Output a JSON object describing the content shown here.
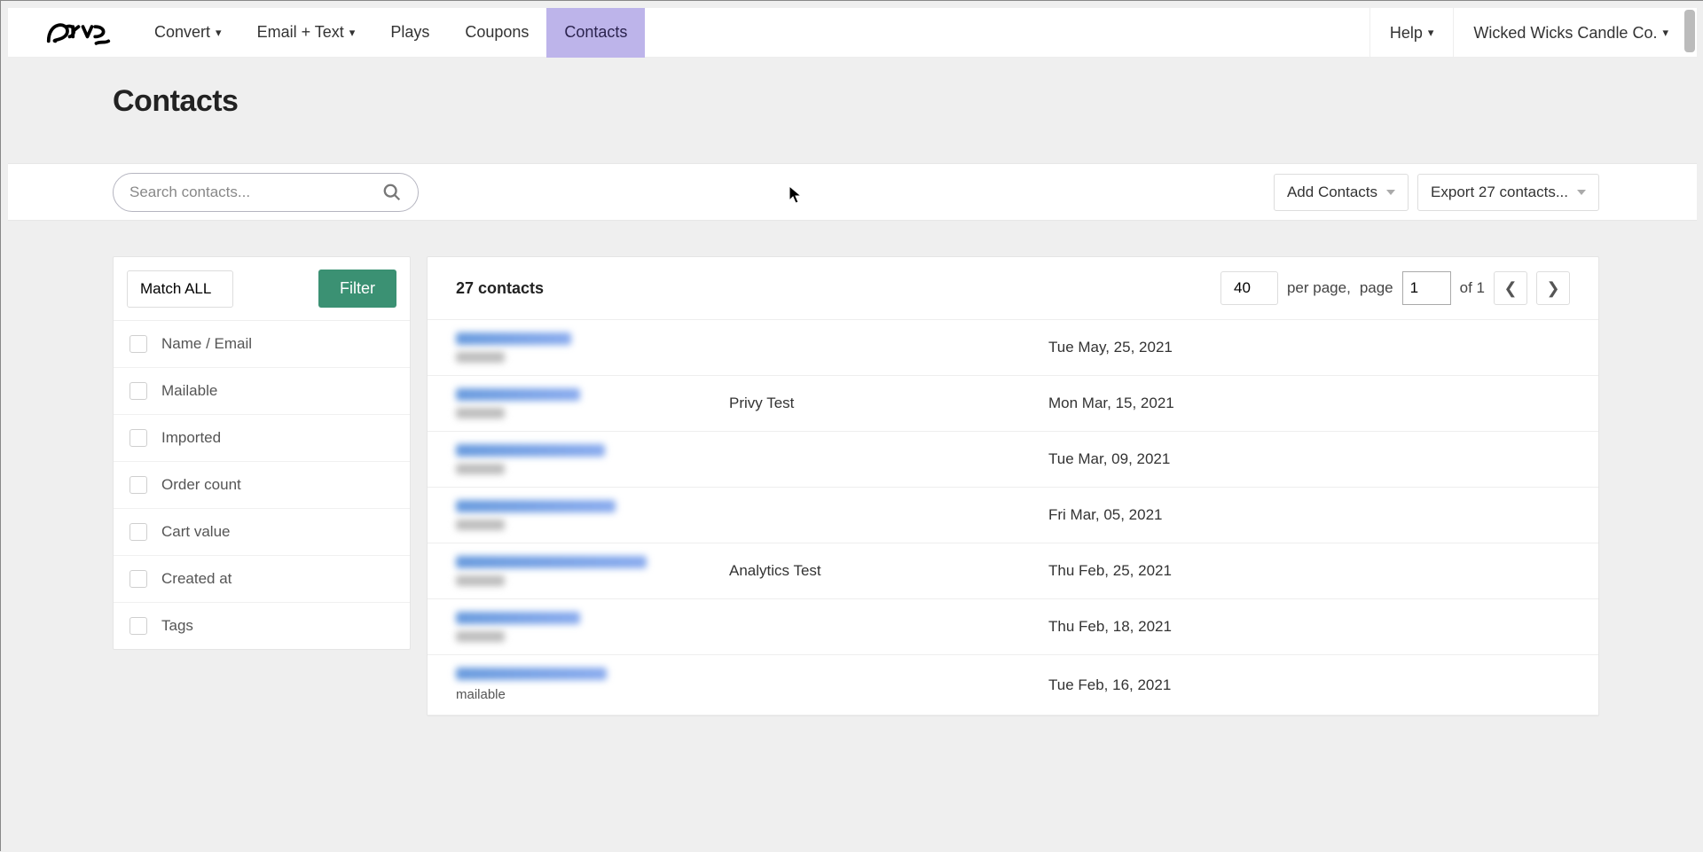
{
  "nav": {
    "items": [
      {
        "label": "Convert",
        "has_menu": true
      },
      {
        "label": "Email + Text",
        "has_menu": true
      },
      {
        "label": "Plays",
        "has_menu": false
      },
      {
        "label": "Coupons",
        "has_menu": false
      },
      {
        "label": "Contacts",
        "has_menu": false,
        "active": true
      }
    ],
    "help": "Help",
    "account": "Wicked Wicks Candle Co."
  },
  "page_title": "Contacts",
  "search": {
    "placeholder": "Search contacts..."
  },
  "toolbar": {
    "add": "Add Contacts",
    "export": "Export 27 contacts..."
  },
  "filters": {
    "match_label": "Match ALL",
    "filter_btn": "Filter",
    "rows": [
      "Name / Email",
      "Mailable",
      "Imported",
      "Order count",
      "Cart value",
      "Created at",
      "Tags"
    ]
  },
  "table": {
    "count_label": "27 contacts",
    "per_page_value": "40",
    "per_page_text": "per page,",
    "page_text": "page",
    "page_value": "1",
    "of_text": "of 1"
  },
  "contacts": [
    {
      "name": "",
      "date": "Tue May, 25, 2021",
      "mailable": false,
      "blur_w": 130
    },
    {
      "name": "Privy Test",
      "date": "Mon Mar, 15, 2021",
      "mailable": false,
      "blur_w": 140
    },
    {
      "name": "",
      "date": "Tue Mar, 09, 2021",
      "mailable": false,
      "blur_w": 168
    },
    {
      "name": "",
      "date": "Fri Mar, 05, 2021",
      "mailable": false,
      "blur_w": 180
    },
    {
      "name": "Analytics Test",
      "date": "Thu Feb, 25, 2021",
      "mailable": false,
      "blur_w": 215
    },
    {
      "name": "",
      "date": "Thu Feb, 18, 2021",
      "mailable": false,
      "blur_w": 140
    },
    {
      "name": "",
      "date": "Tue Feb, 16, 2021",
      "mailable": true,
      "blur_w": 170
    }
  ]
}
